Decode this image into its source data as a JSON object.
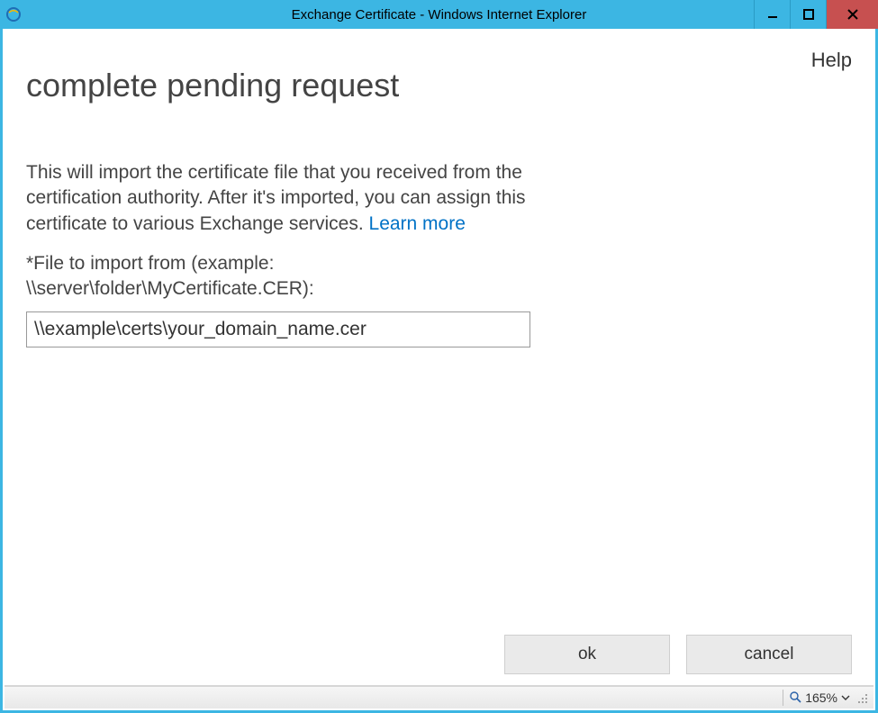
{
  "window": {
    "title": "Exchange Certificate - Windows Internet Explorer"
  },
  "header": {
    "help_label": "Help",
    "page_title": "complete pending request"
  },
  "main": {
    "description": "This will import the certificate file that you received from the certification authority. After it's imported, you can assign this certificate to various Exchange services. ",
    "learn_more_label": "Learn more ",
    "file_label": "*File to import from (example: \\\\server\\folder\\MyCertificate.CER):",
    "file_input_value": "\\\\example\\certs\\your_domain_name.cer"
  },
  "buttons": {
    "ok_label": "ok",
    "cancel_label": "cancel"
  },
  "status": {
    "zoom_label": "165%"
  }
}
